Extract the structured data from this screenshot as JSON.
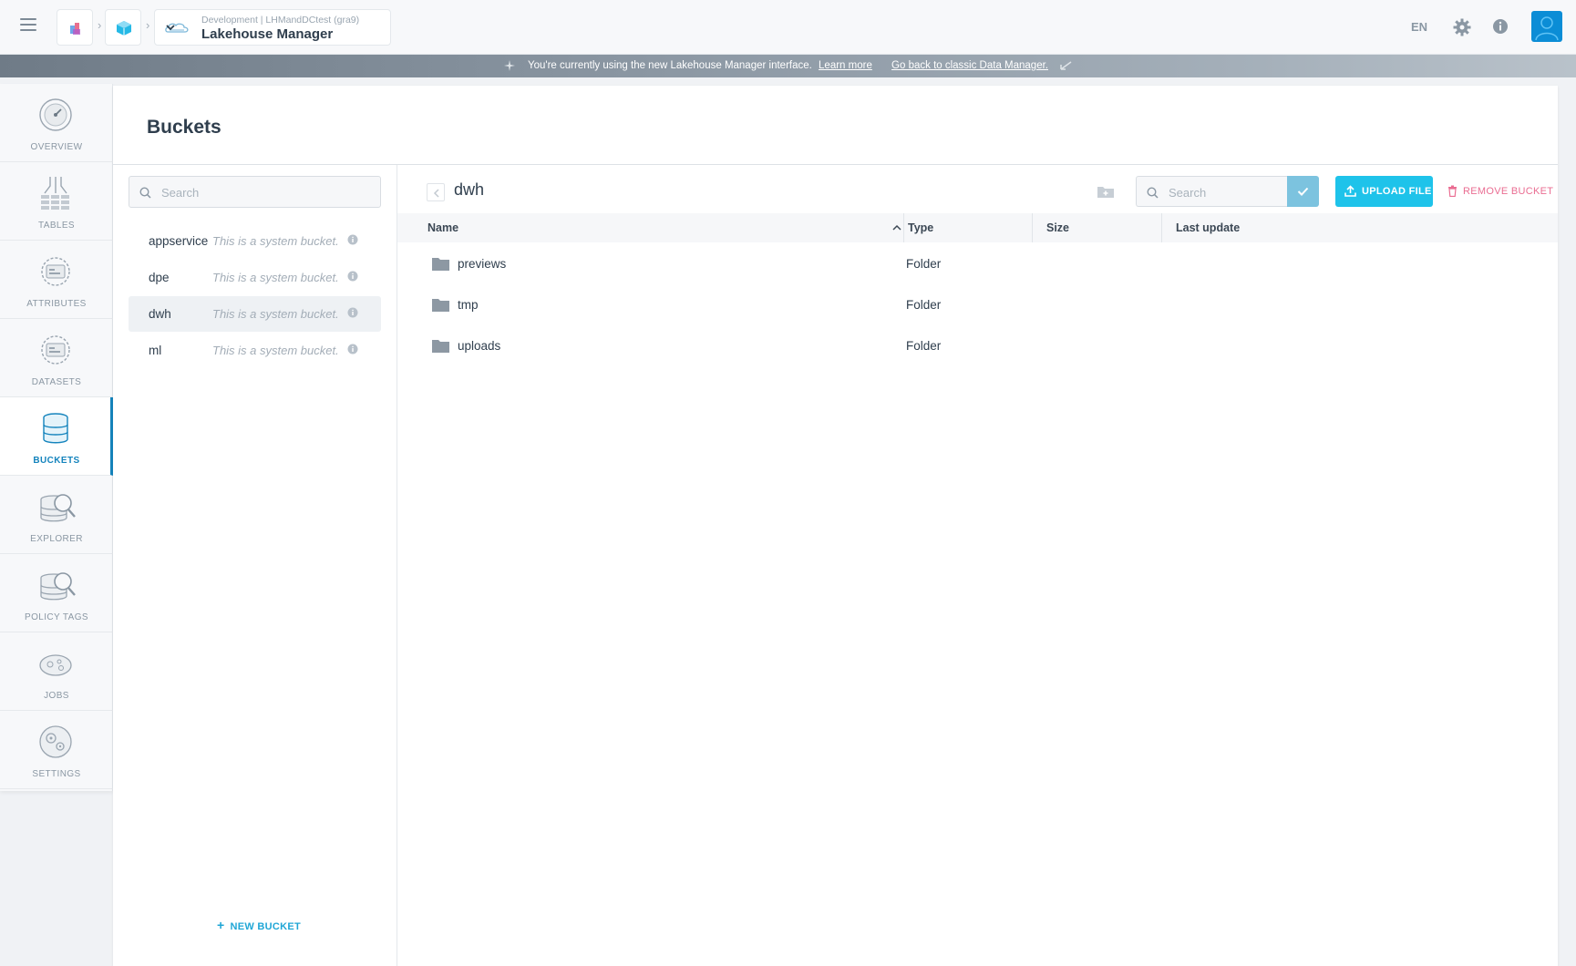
{
  "header": {
    "context_subtitle": "Development | LHMandDCtest (gra9)",
    "context_title": "Lakehouse Manager",
    "language": "EN"
  },
  "banner": {
    "text": "You're currently using the new Lakehouse Manager interface.",
    "learn_more": "Learn more",
    "back_link": "Go back to classic Data Manager."
  },
  "nav": {
    "items": [
      {
        "label": "OVERVIEW",
        "icon": "gauge-icon"
      },
      {
        "label": "TABLES",
        "icon": "tables-icon"
      },
      {
        "label": "ATTRIBUTES",
        "icon": "attributes-icon"
      },
      {
        "label": "DATASETS",
        "icon": "datasets-icon"
      },
      {
        "label": "BUCKETS",
        "icon": "database-icon",
        "active": true
      },
      {
        "label": "EXPLORER",
        "icon": "explorer-icon"
      },
      {
        "label": "POLICY TAGS",
        "icon": "policy-tags-icon"
      },
      {
        "label": "JOBS",
        "icon": "jobs-icon"
      },
      {
        "label": "SETTINGS",
        "icon": "settings-icon"
      }
    ]
  },
  "page": {
    "title": "Buckets"
  },
  "buckets": {
    "search_placeholder": "Search",
    "items": [
      {
        "name": "appservice",
        "description": "This is a system bucket."
      },
      {
        "name": "dpe",
        "description": "This is a system bucket."
      },
      {
        "name": "dwh",
        "description": "This is a system bucket.",
        "selected": true
      },
      {
        "name": "ml",
        "description": "This is a system bucket."
      }
    ],
    "new_bucket_label": "NEW BUCKET"
  },
  "pane": {
    "title": "dwh",
    "search_placeholder": "Search",
    "upload_label": "UPLOAD FILE",
    "remove_label": "REMOVE BUCKET",
    "columns": [
      "Name",
      "Type",
      "Size",
      "Last update"
    ],
    "rows": [
      {
        "name": "previews",
        "type": "Folder",
        "size": "",
        "last_update": ""
      },
      {
        "name": "tmp",
        "type": "Folder",
        "size": "",
        "last_update": ""
      },
      {
        "name": "uploads",
        "type": "Folder",
        "size": "",
        "last_update": ""
      }
    ]
  },
  "colors": {
    "accent": "#1ec3ea",
    "active_nav": "#1584bd",
    "danger": "#ea6d92"
  }
}
